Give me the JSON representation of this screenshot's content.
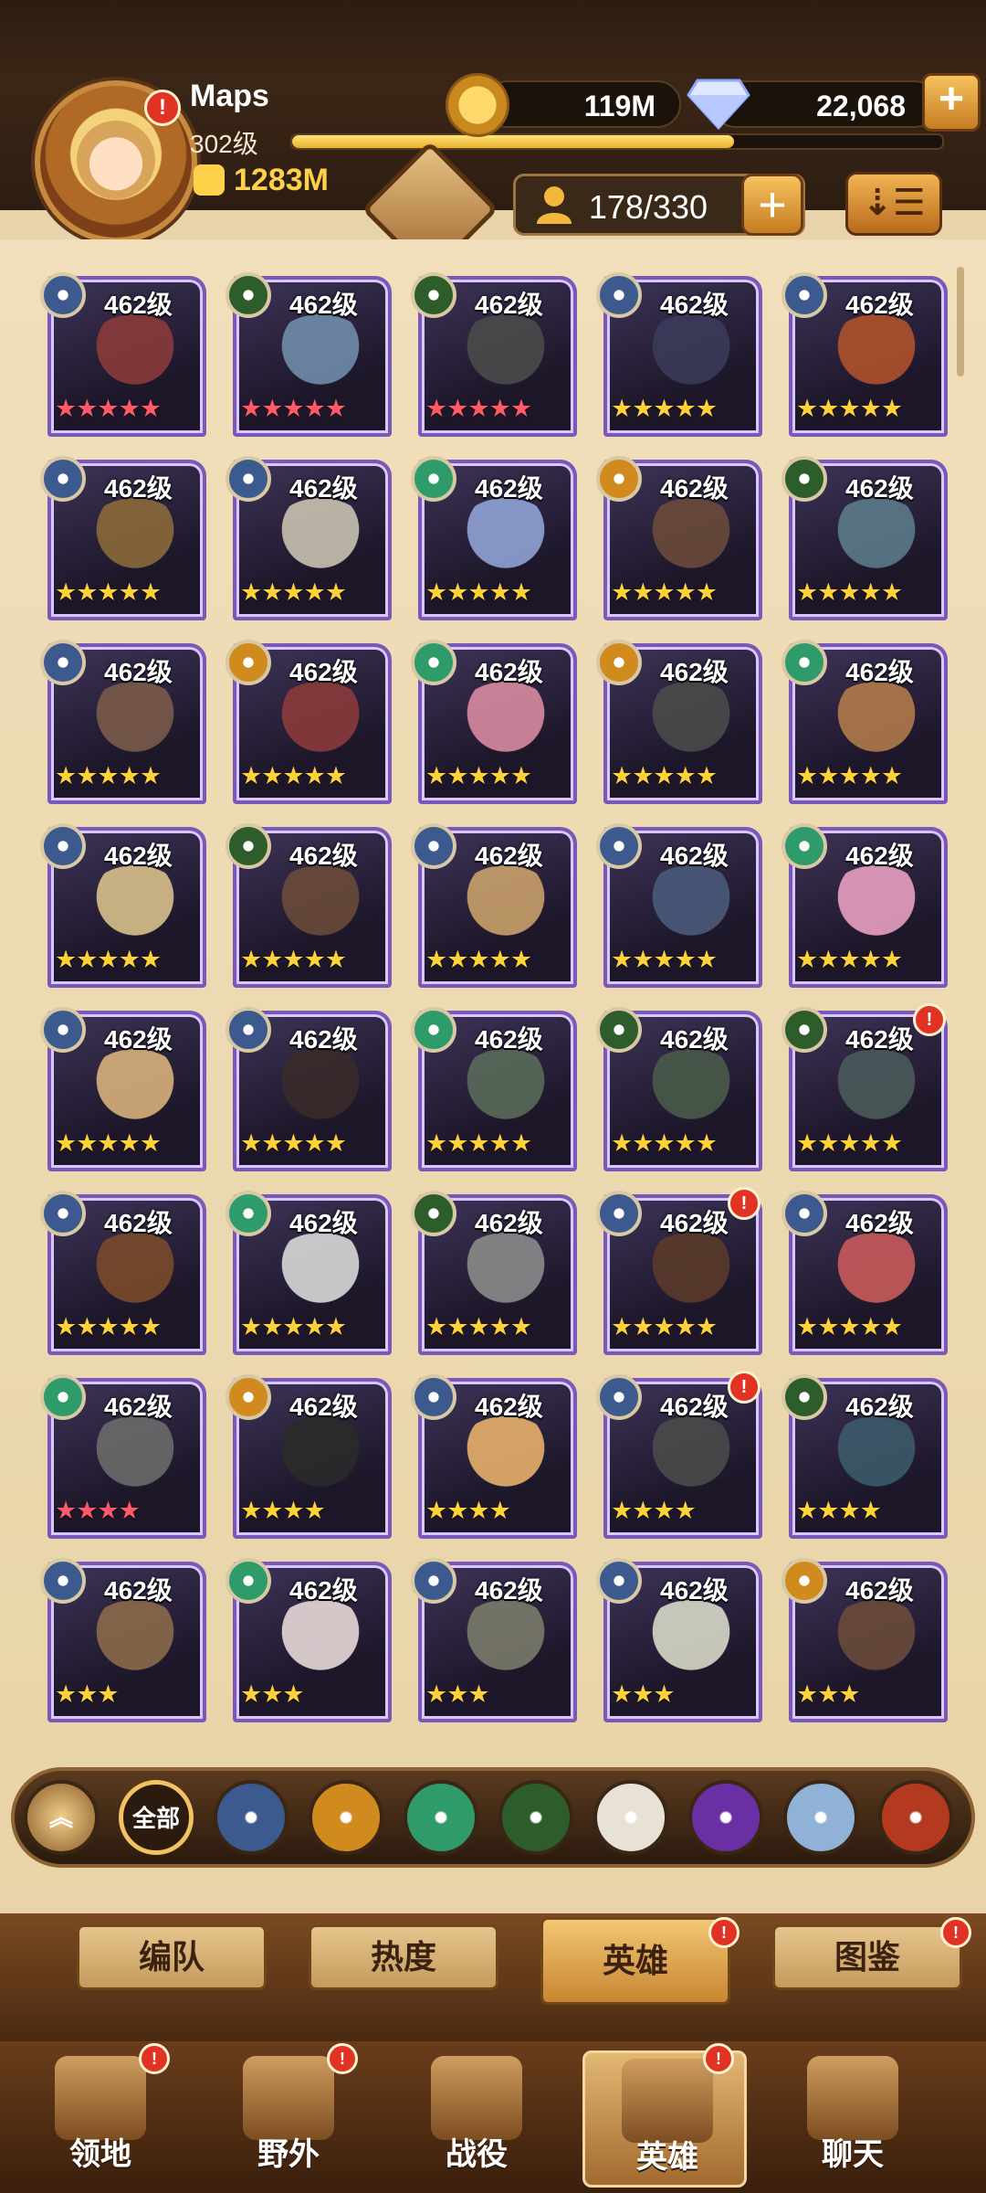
{
  "player": {
    "name": "Maps",
    "level": "302级",
    "power": "1283M",
    "xp_fraction": 0.68
  },
  "resources": {
    "gold": "119M",
    "diamonds": "22,068"
  },
  "hero_slots": "178/330",
  "sort_glyph": "⇣☰",
  "level_text": "462级",
  "colors": {
    "accent": "#ffd04a",
    "frame": "#7a58b8",
    "alert": "#e03324"
  },
  "heroes": [
    {
      "stars": 5,
      "star_color": "red",
      "faction": "lightbearer",
      "alert": false
    },
    {
      "stars": 5,
      "star_color": "red",
      "faction": "graveborn",
      "alert": false
    },
    {
      "stars": 5,
      "star_color": "red",
      "faction": "graveborn",
      "alert": false
    },
    {
      "stars": 5,
      "star_color": "gold",
      "faction": "lightbearer",
      "alert": false
    },
    {
      "stars": 5,
      "star_color": "gold",
      "faction": "lightbearer",
      "alert": false
    },
    {
      "stars": 5,
      "star_color": "gold",
      "faction": "lightbearer",
      "alert": false
    },
    {
      "stars": 5,
      "star_color": "gold",
      "faction": "lightbearer",
      "alert": false
    },
    {
      "stars": 5,
      "star_color": "gold",
      "faction": "wilder",
      "alert": false
    },
    {
      "stars": 5,
      "star_color": "gold",
      "faction": "mauler",
      "alert": false
    },
    {
      "stars": 5,
      "star_color": "gold",
      "faction": "graveborn",
      "alert": false
    },
    {
      "stars": 5,
      "star_color": "gold",
      "faction": "lightbearer",
      "alert": false
    },
    {
      "stars": 5,
      "star_color": "gold",
      "faction": "mauler",
      "alert": false
    },
    {
      "stars": 5,
      "star_color": "gold",
      "faction": "wilder",
      "alert": false
    },
    {
      "stars": 5,
      "star_color": "gold",
      "faction": "mauler",
      "alert": false
    },
    {
      "stars": 5,
      "star_color": "gold",
      "faction": "wilder",
      "alert": false
    },
    {
      "stars": 5,
      "star_color": "gold",
      "faction": "lightbearer",
      "alert": false
    },
    {
      "stars": 5,
      "star_color": "gold",
      "faction": "graveborn",
      "alert": false
    },
    {
      "stars": 5,
      "star_color": "gold",
      "faction": "lightbearer",
      "alert": false
    },
    {
      "stars": 5,
      "star_color": "gold",
      "faction": "lightbearer",
      "alert": false
    },
    {
      "stars": 5,
      "star_color": "gold",
      "faction": "wilder",
      "alert": false
    },
    {
      "stars": 5,
      "star_color": "gold",
      "faction": "lightbearer",
      "alert": false
    },
    {
      "stars": 5,
      "star_color": "gold",
      "faction": "lightbearer",
      "alert": false
    },
    {
      "stars": 5,
      "star_color": "gold",
      "faction": "wilder",
      "alert": false
    },
    {
      "stars": 5,
      "star_color": "gold",
      "faction": "graveborn",
      "alert": false
    },
    {
      "stars": 5,
      "star_color": "gold",
      "faction": "graveborn",
      "alert": true
    },
    {
      "stars": 5,
      "star_color": "gold",
      "faction": "lightbearer",
      "alert": false
    },
    {
      "stars": 5,
      "star_color": "gold",
      "faction": "wilder",
      "alert": false
    },
    {
      "stars": 5,
      "star_color": "gold",
      "faction": "graveborn",
      "alert": false
    },
    {
      "stars": 5,
      "star_color": "gold",
      "faction": "lightbearer",
      "alert": true
    },
    {
      "stars": 5,
      "star_color": "gold",
      "faction": "lightbearer",
      "alert": false
    },
    {
      "stars": 4,
      "star_color": "red",
      "faction": "wilder",
      "alert": false
    },
    {
      "stars": 4,
      "star_color": "gold",
      "faction": "mauler",
      "alert": false
    },
    {
      "stars": 4,
      "star_color": "gold",
      "faction": "lightbearer",
      "alert": false
    },
    {
      "stars": 4,
      "star_color": "gold",
      "faction": "lightbearer",
      "alert": true
    },
    {
      "stars": 4,
      "star_color": "gold",
      "faction": "graveborn",
      "alert": false
    },
    {
      "stars": 3,
      "star_color": "gold",
      "faction": "lightbearer",
      "alert": false
    },
    {
      "stars": 3,
      "star_color": "gold",
      "faction": "wilder",
      "alert": false
    },
    {
      "stars": 3,
      "star_color": "gold",
      "faction": "lightbearer",
      "alert": false
    },
    {
      "stars": 3,
      "star_color": "gold",
      "faction": "lightbearer",
      "alert": false
    },
    {
      "stars": 3,
      "star_color": "gold",
      "faction": "mauler",
      "alert": false
    }
  ],
  "filters": [
    {
      "name": "collapse",
      "label": "",
      "color": "#c9a06a"
    },
    {
      "name": "all",
      "label": "全部",
      "color": "#4a3320"
    },
    {
      "name": "lightbearer",
      "label": "",
      "color": "#3c5a8e"
    },
    {
      "name": "mauler",
      "label": "",
      "color": "#d08a1e"
    },
    {
      "name": "wilder",
      "label": "",
      "color": "#2f9a6a"
    },
    {
      "name": "graveborn",
      "label": "",
      "color": "#2d5d2a"
    },
    {
      "name": "celestial",
      "label": "",
      "color": "#e8e2d6"
    },
    {
      "name": "hypogean",
      "label": "",
      "color": "#6b2fa4"
    },
    {
      "name": "dimensional",
      "label": "",
      "color": "#8fb2d6"
    },
    {
      "name": "dragon",
      "label": "",
      "color": "#b33a1e"
    }
  ],
  "subtabs": [
    {
      "label": "编队",
      "alert": false
    },
    {
      "label": "热度",
      "alert": false
    },
    {
      "label": "英雄",
      "alert": true,
      "active": true
    },
    {
      "label": "图鉴",
      "alert": true
    }
  ],
  "nav": [
    {
      "label": "领地",
      "alert": true
    },
    {
      "label": "野外",
      "alert": true
    },
    {
      "label": "战役",
      "alert": false
    },
    {
      "label": "英雄",
      "alert": true,
      "active": true
    },
    {
      "label": "聊天",
      "alert": false
    }
  ]
}
